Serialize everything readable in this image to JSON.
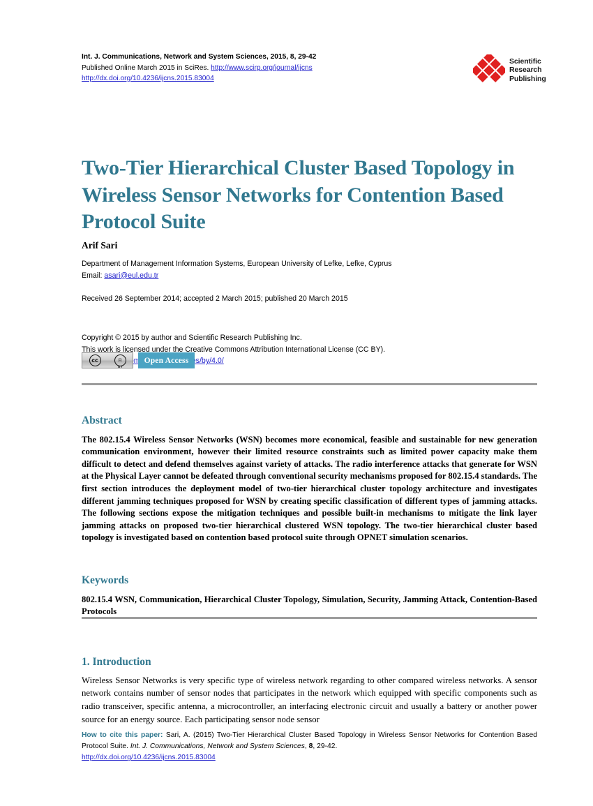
{
  "header": {
    "journal_line": "Int. J. Communications, Network and System Sciences, 2015, 8, 29-42",
    "published_prefix": "Published Online March 2015 in SciRes. ",
    "journal_url": "http://www.scirp.org/journal/ijcns",
    "doi_url": "http://dx.doi.org/10.4236/ijcns.2015.83004"
  },
  "logo": {
    "line1": "Scientific",
    "line2": "Research",
    "line3": "Publishing",
    "color": "#E02020"
  },
  "title": "Two-Tier Hierarchical Cluster Based Topology in Wireless Sensor Networks for Contention Based Protocol Suite",
  "author": {
    "name": "Arif Sari",
    "affiliation": "Department of Management Information Systems, European University of Lefke, Lefke, Cyprus",
    "email_label": "Email: ",
    "email": "asari@eul.edu.tr"
  },
  "dates": "Received 26 September 2014; accepted 2 March 2015; published 20 March 2015",
  "copyright": {
    "line1": "Copyright © 2015 by author and Scientific Research Publishing Inc.",
    "line2": "This work is licensed under the Creative Commons Attribution International License (CC BY).",
    "license_url": "http://creativecommons.org/licenses/by/4.0/"
  },
  "badges": {
    "cc_mark": "cc",
    "by_mark": "BY",
    "open_access": "Open Access",
    "open_access_color": "#4BA3C3"
  },
  "abstract": {
    "heading": "Abstract",
    "body": "The 802.15.4 Wireless Sensor Networks (WSN) becomes more economical, feasible and sustainable for new generation communication environment, however their limited resource constraints such as limited power capacity make them difficult to detect and defend themselves against variety of attacks. The radio interference attacks that generate for WSN at the Physical Layer cannot be defeated through conventional security mechanisms proposed for 802.15.4 standards. The first section introduces the deployment model of two-tier hierarchical cluster topology architecture and investigates different jamming techniques proposed for WSN by creating specific classification of different types of jamming attacks. The following sections expose the mitigation techniques and possible built-in mechanisms to mitigate the link layer jamming attacks on proposed two-tier hierarchical clustered WSN topology. The two-tier hierarchical cluster based topology is investigated based on contention based protocol suite through OPNET simulation scenarios."
  },
  "keywords": {
    "heading": "Keywords",
    "body": "802.15.4 WSN, Communication, Hierarchical Cluster Topology, Simulation, Security, Jamming Attack, Contention-Based Protocols"
  },
  "introduction": {
    "heading": "1. Introduction",
    "body": "Wireless Sensor Networks is very specific type of wireless network regarding to other compared wireless networks. A sensor network contains number of sensor nodes that participates in the network which equipped with specific components such as radio transceiver, specific antenna, a microcontroller, an interfacing electronic circuit and usually a battery or another power source for an energy source. Each participating sensor node sensor"
  },
  "footer": {
    "label": "How to cite this paper:",
    "citation_part1": " Sari, A. (2015) Two-Tier Hierarchical Cluster Based Topology in Wireless Sensor Networks for Contention Based Protocol Suite. ",
    "journal_italic": "Int. J. Communications, Network and System Sciences",
    "citation_part2": ", ",
    "volume": "8",
    "pages": ", 29-42.",
    "doi_url": "http://dx.doi.org/10.4236/ijcns.2015.83004"
  },
  "theme": {
    "accent": "#31788F",
    "link": "#2222cc",
    "rule": "#9d9d9d"
  }
}
